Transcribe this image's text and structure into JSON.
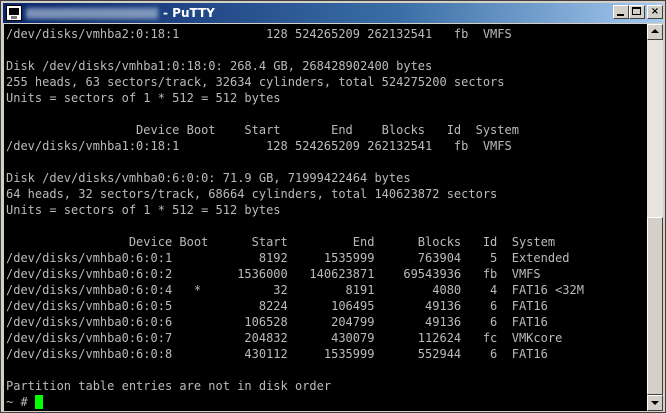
{
  "window": {
    "title": "- PuTTY",
    "icon": "putty-terminal-icon",
    "buttons": {
      "minimize": "minimize-icon",
      "maximize": "maximize-icon",
      "close": "×"
    }
  },
  "terminal": {
    "lines": [
      "/dev/disks/vmhba2:0:18:1            128 524265209 262132541   fb  VMFS",
      "",
      "Disk /dev/disks/vmhba1:0:18:0: 268.4 GB, 268428902400 bytes",
      "255 heads, 63 sectors/track, 32634 cylinders, total 524275200 sectors",
      "Units = sectors of 1 * 512 = 512 bytes",
      "",
      "                  Device Boot    Start       End    Blocks   Id  System",
      "/dev/disks/vmhba1:0:18:1            128 524265209 262132541   fb  VMFS",
      "",
      "Disk /dev/disks/vmhba0:6:0:0: 71.9 GB, 71999422464 bytes",
      "64 heads, 32 sectors/track, 68664 cylinders, total 140623872 sectors",
      "Units = sectors of 1 * 512 = 512 bytes",
      "",
      "                 Device Boot      Start         End      Blocks   Id  System",
      "/dev/disks/vmhba0:6:0:1            8192     1535999      763904    5  Extended",
      "/dev/disks/vmhba0:6:0:2         1536000   140623871    69543936   fb  VMFS",
      "/dev/disks/vmhba0:6:0:4   *          32        8191        4080    4  FAT16 <32M",
      "/dev/disks/vmhba0:6:0:5            8224      106495       49136    6  FAT16",
      "/dev/disks/vmhba0:6:0:6          106528      204799       49136    6  FAT16",
      "/dev/disks/vmhba0:6:0:7          204832      430079      112624   fc  VMKcore",
      "/dev/disks/vmhba0:6:0:8          430112     1535999      552944    6  FAT16",
      "",
      "Partition table entries are not in disk order"
    ],
    "prompt": "~ # ",
    "colors": {
      "background": "#000000",
      "foreground": "#bbbbbb",
      "cursor": "#00ff00"
    }
  },
  "scrollbar": {
    "position_fraction": 1.0,
    "visible_fraction": 0.5
  }
}
